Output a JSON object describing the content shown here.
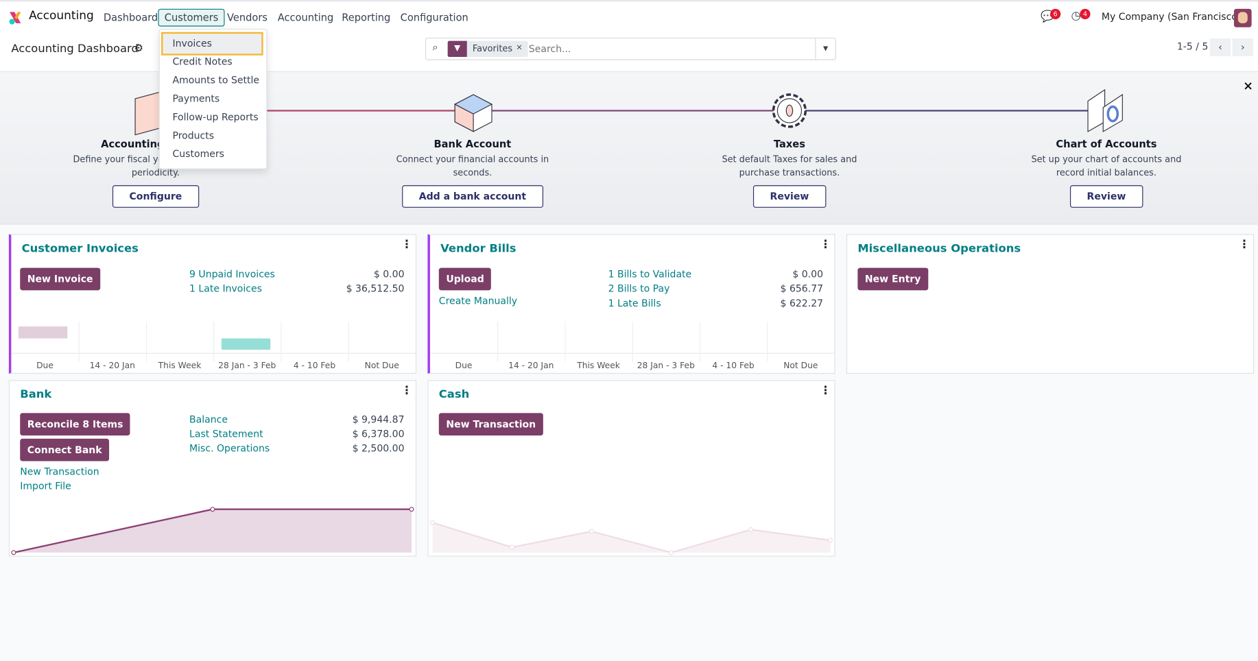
{
  "nav": {
    "app": "Accounting",
    "items": [
      "Dashboard",
      "Customers",
      "Vendors",
      "Accounting",
      "Reporting",
      "Configuration"
    ],
    "active": "Customers",
    "messages_badge": "6",
    "activities_badge": "4",
    "company": "My Company (San Francisco)"
  },
  "control": {
    "title": "Accounting Dashboard",
    "facet": "Favorites",
    "search_placeholder": "Search...",
    "pager": "1-5 / 5"
  },
  "dropdown": {
    "items": [
      "Invoices",
      "Credit Notes",
      "Amounts to Settle",
      "Payments",
      "Follow-up Reports",
      "Products",
      "Customers"
    ],
    "highlighted": "Invoices"
  },
  "onboarding": {
    "steps": [
      {
        "title": "Accounting Periods",
        "desc": "Define your fiscal years & tax returns periodicity.",
        "button": "Configure"
      },
      {
        "title": "Bank Account",
        "desc": "Connect your financial accounts in seconds.",
        "button": "Add a bank account"
      },
      {
        "title": "Taxes",
        "desc": "Set default Taxes for sales and purchase transactions.",
        "button": "Review"
      },
      {
        "title": "Chart of Accounts",
        "desc": "Set up your chart of accounts and record initial balances.",
        "button": "Review"
      }
    ],
    "close": "×"
  },
  "cards": {
    "customer_invoices": {
      "title": "Customer Invoices",
      "button": "New Invoice",
      "stats": [
        {
          "label": "9 Unpaid Invoices",
          "amount": "$ 0.00"
        },
        {
          "label": "1 Late Invoices",
          "amount": "$ 36,512.50"
        }
      ],
      "x_labels": [
        "Due",
        "14 - 20 Jan",
        "This Week",
        "28 Jan - 3 Feb",
        "4 - 10 Feb",
        "Not Due"
      ]
    },
    "vendor_bills": {
      "title": "Vendor Bills",
      "button": "Upload",
      "link": "Create Manually",
      "stats": [
        {
          "label": "1 Bills to Validate",
          "amount": "$ 0.00"
        },
        {
          "label": "2 Bills to Pay",
          "amount": "$ 656.77"
        },
        {
          "label": "1 Late Bills",
          "amount": "$ 622.27"
        }
      ],
      "x_labels": [
        "Due",
        "14 - 20 Jan",
        "This Week",
        "28 Jan - 3 Feb",
        "4 - 10 Feb",
        "Not Due"
      ]
    },
    "misc": {
      "title": "Miscellaneous Operations",
      "button": "New Entry"
    },
    "bank": {
      "title": "Bank",
      "buttons": [
        "Reconcile 8 Items",
        "Connect Bank"
      ],
      "links": [
        "New Transaction",
        "Import File"
      ],
      "stats": [
        {
          "label": "Balance",
          "amount": "$ 9,944.87"
        },
        {
          "label": "Last Statement",
          "amount": "$ 6,378.00"
        },
        {
          "label": "Misc. Operations",
          "amount": "$ 2,500.00"
        }
      ],
      "graph": [
        0,
        1,
        1
      ]
    },
    "cash": {
      "title": "Cash",
      "button": "New Transaction",
      "graph": [
        0.85,
        0.15,
        0.6,
        0,
        0.65,
        0.35
      ]
    }
  },
  "colors": {
    "primary": "#7a3e67",
    "link": "#017e84",
    "navy": "#2d3068"
  }
}
